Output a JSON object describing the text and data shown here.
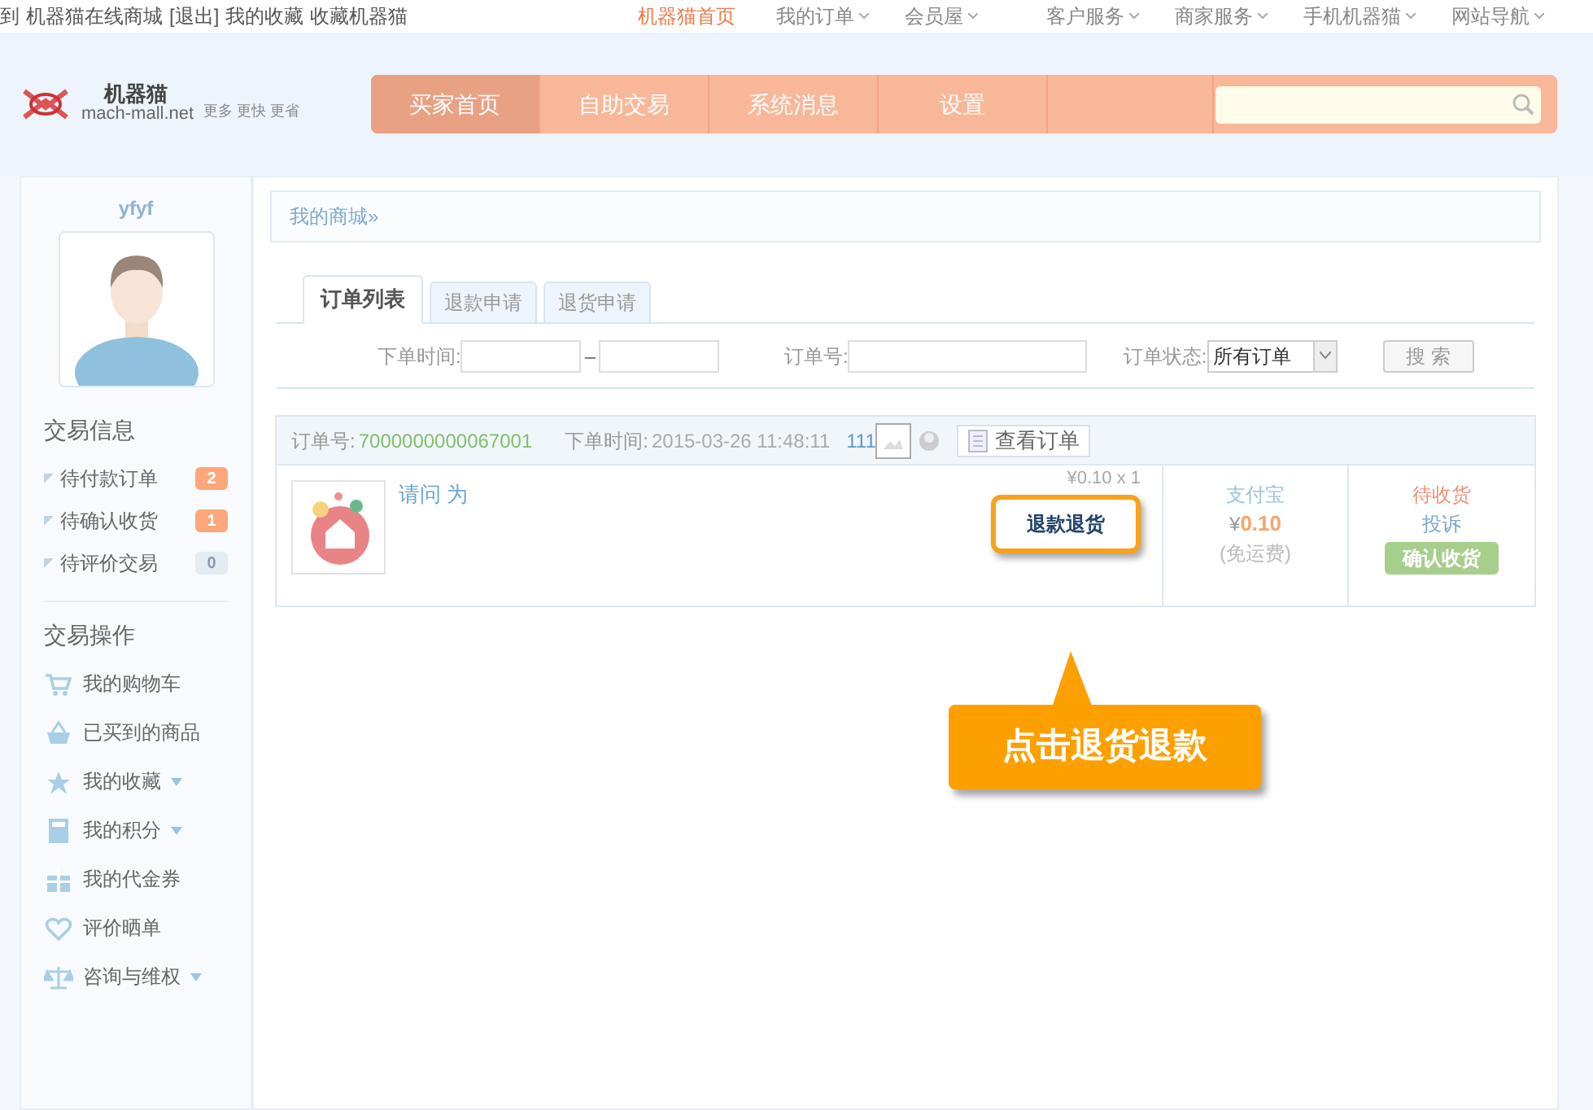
{
  "top_bar": {
    "left_links": [
      "到",
      "机器猫在线商城",
      "[退出]",
      "我的收藏",
      "收藏机器猫"
    ],
    "right_links": [
      {
        "label": "机器猫首页",
        "selected": true,
        "dropdown": false
      },
      {
        "label": "我的订单",
        "selected": false,
        "dropdown": true
      },
      {
        "label": "会员屋",
        "selected": false,
        "dropdown": true
      },
      {
        "label": "客户服务",
        "selected": false,
        "dropdown": true
      },
      {
        "label": "商家服务",
        "selected": false,
        "dropdown": true
      },
      {
        "label": "手机机器猫",
        "selected": false,
        "dropdown": true
      },
      {
        "label": "网站导航",
        "selected": false,
        "dropdown": true
      }
    ]
  },
  "logo": {
    "name": "机器猫",
    "domain": "mach-mall.net",
    "slogan": "更多 更快 更省"
  },
  "nav": [
    {
      "label": "买家首页",
      "selected": true
    },
    {
      "label": "自助交易",
      "selected": false
    },
    {
      "label": "系统消息",
      "selected": false
    },
    {
      "label": "设置",
      "selected": false
    }
  ],
  "sidebar": {
    "username": "yfyf",
    "info_title": "交易信息",
    "info_items": [
      {
        "label": "待付款订单",
        "count": "2",
        "active": true
      },
      {
        "label": "待确认收货",
        "count": "1",
        "active": true
      },
      {
        "label": "待评价交易",
        "count": "0",
        "active": false
      }
    ],
    "ops_title": "交易操作",
    "ops_items": [
      {
        "label": "我的购物车",
        "dropdown": false
      },
      {
        "label": "已买到的商品",
        "dropdown": false
      },
      {
        "label": "我的收藏",
        "dropdown": true
      },
      {
        "label": "我的积分",
        "dropdown": true
      },
      {
        "label": "我的代金券",
        "dropdown": false
      },
      {
        "label": "评价晒单",
        "dropdown": false
      },
      {
        "label": "咨询与维权",
        "dropdown": true
      }
    ]
  },
  "breadcrumb": "我的商城»",
  "tabs": [
    {
      "label": "订单列表",
      "selected": true
    },
    {
      "label": "退款申请",
      "selected": false
    },
    {
      "label": "退货申请",
      "selected": false
    }
  ],
  "filters": {
    "time_label": "下单时间:",
    "dash": "–",
    "order_no_label": "订单号:",
    "status_label": "订单状态:",
    "status_value": "所有订单",
    "search_button": "搜 索"
  },
  "order": {
    "no_label": "订单号:",
    "no": "7000000000067001",
    "time_label": "下单时间:",
    "time": "2015-03-26 11:48:11",
    "extra": "111",
    "view_button": "查看订单",
    "item_name": "请问 为",
    "price_qty": "¥0.10 x 1",
    "refund_button": "退款退货",
    "payment": "支付宝",
    "amount_symbol": "¥",
    "amount": "0.10",
    "shipping": "(免运费)",
    "status": "待收货",
    "complaint": "投诉",
    "confirm_button": "确认收货"
  },
  "callout": "点击退货退款"
}
